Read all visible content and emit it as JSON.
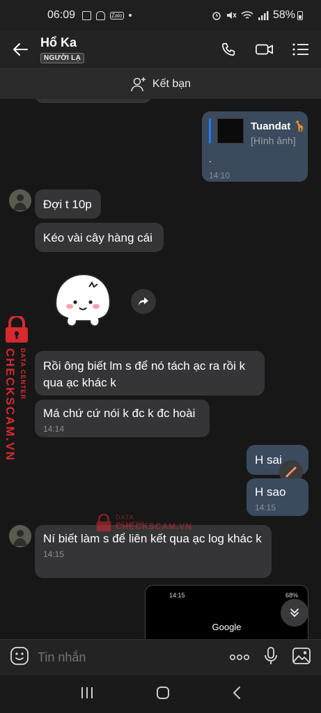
{
  "status_bar": {
    "time": "06:09",
    "zalo": "Zalo",
    "battery": "58%"
  },
  "header": {
    "name": "Hổ Ka",
    "badge": "NGƯỜI LẠ"
  },
  "friend_bar": {
    "label": "Kết bạn"
  },
  "messages": {
    "quote": {
      "sender": "Tuandat 🦒",
      "sub": "[Hình ảnh]",
      "text": ".",
      "time": "14:10"
    },
    "m1": "Đợi t 10p",
    "m2": "Kéo vài cây hàng cái",
    "m3": "Rồi ông biết lm s để nó tách ạc ra rồi k qua ạc khác k",
    "m4": "Má chứ cứ nói k đc k đc hoài",
    "m4_time": "14:14",
    "m5": "H sai",
    "m6": "H sao",
    "m6_time": "14:15",
    "m7": "Ní biết làm s để liên kết qua ạc log khác k",
    "m7_time": "14:15"
  },
  "watermark": {
    "brand": "CHECKSCAM.VN",
    "tagline": "DATA CENTER"
  },
  "screenshot_preview": {
    "time": "14:15",
    "battery": "68%",
    "text": "Google"
  },
  "input": {
    "placeholder": "Tin nhắn"
  },
  "colors": {
    "background": "#171717",
    "incoming": "#353538",
    "outgoing": "#3b4a5c",
    "accent": "#1b7cff",
    "watermark": "#d62a2f"
  }
}
